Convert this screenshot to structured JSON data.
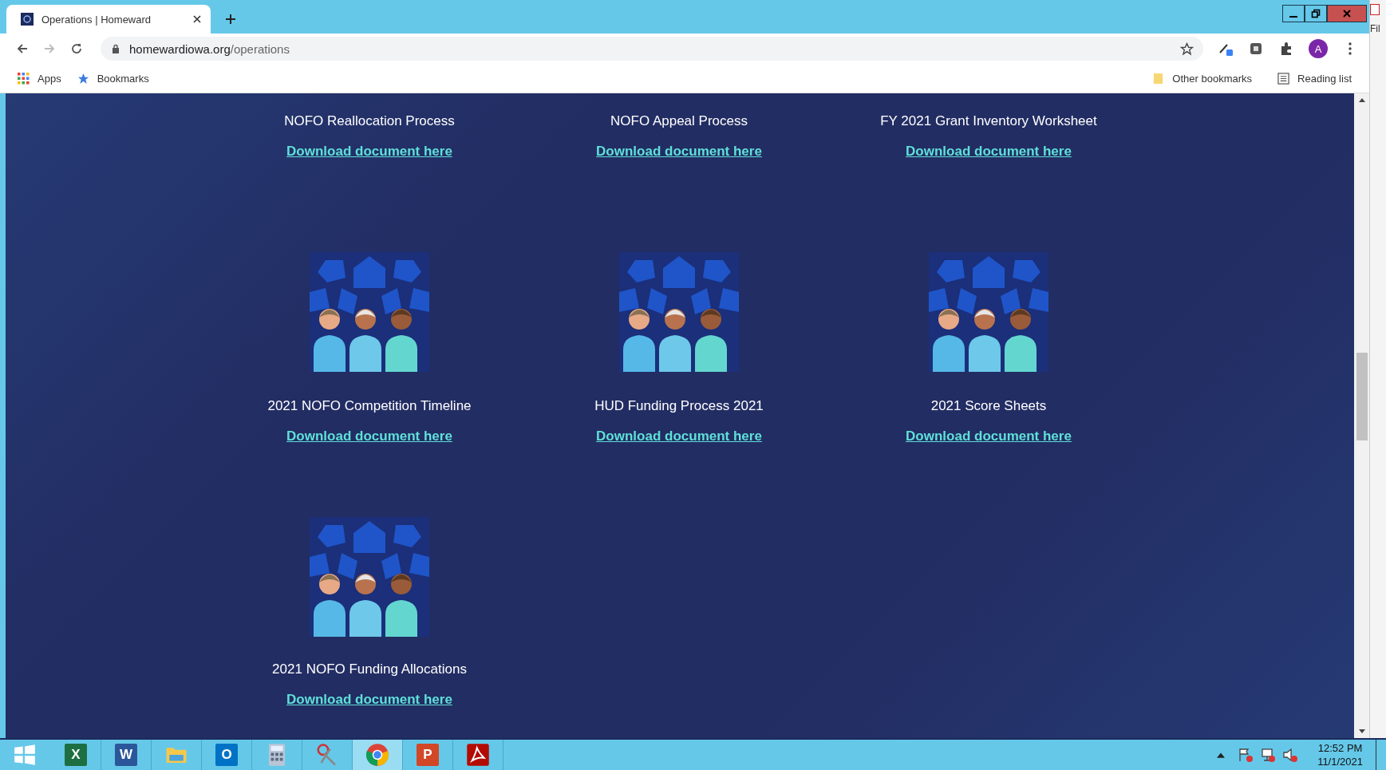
{
  "tab": {
    "title": "Operations | Homeward",
    "selected": true
  },
  "address_bar": {
    "domain": "homewardiowa.org",
    "path": "/operations"
  },
  "profile": {
    "initial": "A"
  },
  "bookmarks": {
    "left": [
      "Apps",
      "Bookmarks"
    ],
    "right": [
      "Other bookmarks",
      "Reading list"
    ]
  },
  "documents": [
    {
      "title": "NOFO Reallocation Process",
      "link": "Download document here",
      "image": false
    },
    {
      "title": "NOFO Appeal Process",
      "link": "Download document here",
      "image": false
    },
    {
      "title": "FY 2021 Grant Inventory Worksheet",
      "link": "Download document here",
      "image": false
    },
    {
      "title": "2021 NOFO Competition Timeline",
      "link": "Download document here",
      "image": true
    },
    {
      "title": "HUD Funding Process 2021",
      "link": "Download document here",
      "image": true
    },
    {
      "title": "2021 Score Sheets",
      "link": "Download document here",
      "image": true
    },
    {
      "title": "2021 NOFO Funding Allocations",
      "link": "Download document here",
      "image": true
    }
  ],
  "side_window": {
    "text": "Fil"
  },
  "taskbar": {
    "apps": [
      {
        "kind": "excel",
        "label": "X",
        "selected": false
      },
      {
        "kind": "word",
        "label": "W",
        "selected": false
      },
      {
        "kind": "folder",
        "selected": false
      },
      {
        "kind": "outlook",
        "label": "O",
        "selected": false
      },
      {
        "kind": "calculator",
        "selected": false
      },
      {
        "kind": "scissors",
        "selected": false
      },
      {
        "kind": "chrome",
        "selected": true
      },
      {
        "kind": "powerpoint",
        "label": "P",
        "selected": false
      },
      {
        "kind": "acrobat",
        "selected": false
      }
    ],
    "time": "12:52 PM",
    "date": "11/1/2021"
  }
}
